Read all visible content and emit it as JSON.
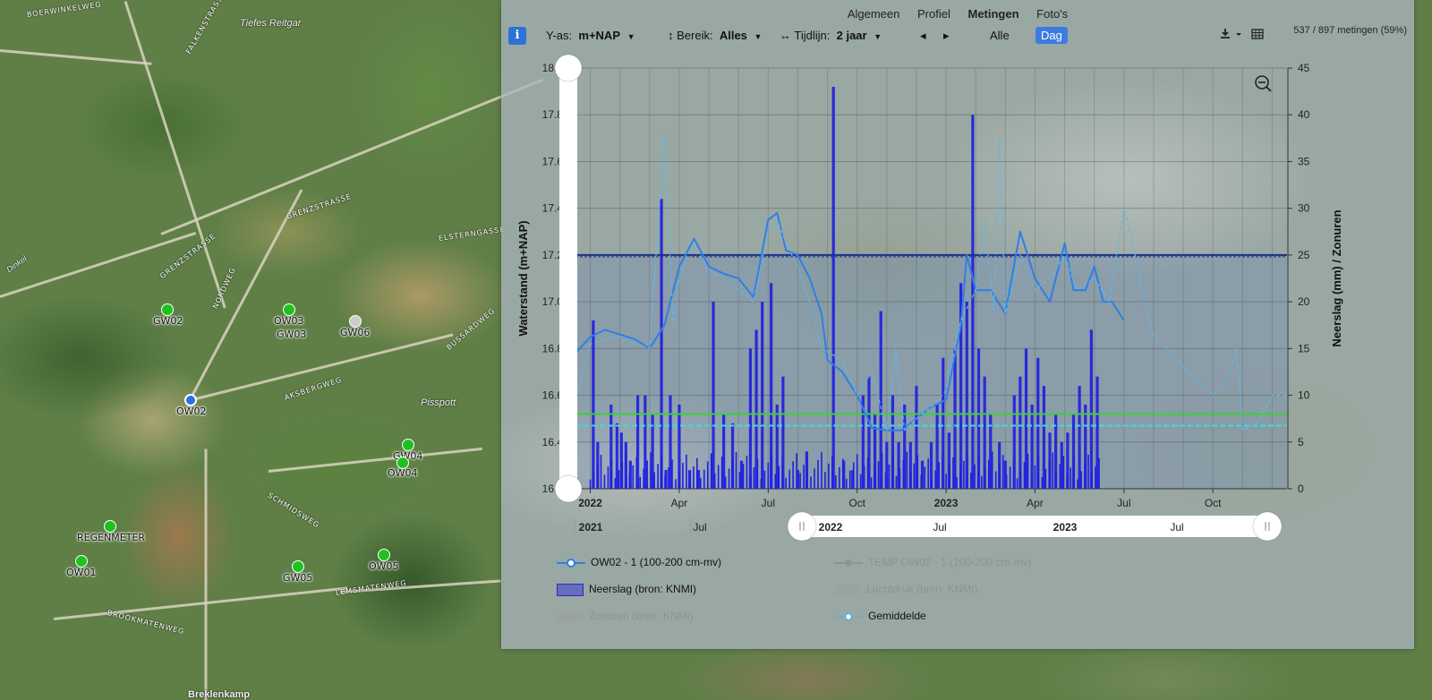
{
  "map": {
    "place_labels": [
      "Tiefes Reitgar",
      "Pisspott",
      "Breklenkamp",
      "Dinkel"
    ],
    "road_labels": [
      "BOERWINKELWEG",
      "FALKENSTRASSE",
      "GRENZSTRASSE",
      "GRENZSTRASSE",
      "NORDWEG",
      "ELSTERNGASSE",
      "BUSSARDWEG",
      "AKSBERGWEG",
      "BROOKMATENWEG",
      "LEMSMATENWEG",
      "SCHMIDSWEG"
    ],
    "markers": [
      {
        "label": "GW02",
        "color": "green"
      },
      {
        "label": "OW03",
        "color": "green"
      },
      {
        "label": "GW03",
        "color": "green"
      },
      {
        "label": "GW06",
        "color": "grey"
      },
      {
        "label": "OW02",
        "color": "blue"
      },
      {
        "label": "GW04",
        "color": "green"
      },
      {
        "label": "OW04",
        "color": "green"
      },
      {
        "label": "REGENMETER",
        "color": "green"
      },
      {
        "label": "OW01",
        "color": "green"
      },
      {
        "label": "GW05",
        "color": "green"
      },
      {
        "label": "OW05",
        "color": "green"
      }
    ]
  },
  "panel": {
    "tabs": [
      "Algemeen",
      "Profiel",
      "Metingen",
      "Foto's"
    ],
    "active_tab": "Metingen",
    "info_label": "i",
    "yas_label": "Y-as:",
    "yas_value": "m+NAP",
    "bereik_label": "Bereik:",
    "bereik_value": "Alles",
    "tijdlijn_label": "Tijdlijn:",
    "tijdlijn_value": "2 jaar",
    "prev_icon": "◂",
    "next_icon": "▸",
    "alle_label": "Alle",
    "dag_label": "Dag",
    "download_icon": "download-icon",
    "table_icon": "table-icon",
    "count_text": "537 / 897 metingen (59%)"
  },
  "chart_data": {
    "type": "line",
    "ylabel": "Waterstand (m+NAP)",
    "y2label": "Neerslag (mm) / Zonuren",
    "ylim": [
      16.2,
      18.0
    ],
    "y2lim": [
      0,
      45
    ],
    "yticks": [
      "18.0",
      "17.8",
      "17.6",
      "17.4",
      "17.2",
      "17.0",
      "16.8",
      "16.6",
      "16.4",
      "16.2"
    ],
    "y2ticks": [
      "45",
      "40",
      "35",
      "30",
      "25",
      "20",
      "15",
      "10",
      "5",
      "0"
    ],
    "xticks": [
      "2022",
      "Apr",
      "Jul",
      "Oct",
      "2023",
      "Apr",
      "Jul",
      "Oct"
    ],
    "xlim_months": [
      -0.5,
      23.5
    ],
    "reference_lines": [
      {
        "name": "high",
        "value": 17.2,
        "color": "#1b2f8a"
      },
      {
        "name": "low-green",
        "value": 16.52,
        "color": "#39d13a"
      },
      {
        "name": "Gemiddelde",
        "value": 16.47,
        "color": "#3fd8e6"
      }
    ],
    "series": [
      {
        "name": "OW02 - 1 (100-200 cm-mv)",
        "color": "#2e7fe8",
        "points": [
          [
            -0.5,
            16.78
          ],
          [
            0,
            16.85
          ],
          [
            0.5,
            16.88
          ],
          [
            1,
            16.86
          ],
          [
            1.5,
            16.84
          ],
          [
            2,
            16.8
          ],
          [
            2.5,
            16.9
          ],
          [
            3,
            17.15
          ],
          [
            3.5,
            17.27
          ],
          [
            4,
            17.15
          ],
          [
            4.5,
            17.12
          ],
          [
            5,
            17.1
          ],
          [
            5.5,
            17.02
          ],
          [
            6,
            17.35
          ],
          [
            6.3,
            17.38
          ],
          [
            6.6,
            17.22
          ],
          [
            7,
            17.2
          ],
          [
            7.4,
            17.1
          ],
          [
            7.8,
            16.95
          ],
          [
            8,
            16.75
          ],
          [
            8.5,
            16.7
          ],
          [
            9,
            16.6
          ],
          [
            9.5,
            16.46
          ],
          [
            10,
            16.45
          ],
          [
            10.5,
            16.45
          ],
          [
            11,
            16.5
          ],
          [
            11.5,
            16.55
          ],
          [
            12,
            16.58
          ],
          [
            12.5,
            16.9
          ],
          [
            12.7,
            17.2
          ],
          [
            13,
            17.05
          ],
          [
            13.5,
            17.05
          ],
          [
            14,
            16.95
          ],
          [
            14.5,
            17.3
          ],
          [
            15,
            17.1
          ],
          [
            15.5,
            17.0
          ],
          [
            16,
            17.25
          ],
          [
            16.3,
            17.05
          ],
          [
            16.7,
            17.05
          ],
          [
            17,
            17.15
          ],
          [
            17.3,
            17.0
          ],
          [
            17.6,
            17.0
          ],
          [
            18,
            16.92
          ]
        ]
      },
      {
        "name": "Gemiddelde",
        "color": "#5ab8f0",
        "dashed": true,
        "points": [
          [
            -0.5,
            16.58
          ],
          [
            0,
            16.82
          ],
          [
            0.5,
            16.84
          ],
          [
            1,
            16.85
          ],
          [
            1.5,
            16.82
          ],
          [
            2,
            16.8
          ],
          [
            2.5,
            17.72
          ],
          [
            2.8,
            16.9
          ],
          [
            3,
            17.1
          ],
          [
            3.5,
            17.25
          ],
          [
            4,
            17.13
          ],
          [
            4.5,
            17.1
          ],
          [
            5,
            17.05
          ],
          [
            5.5,
            17.0
          ],
          [
            6,
            17.3
          ],
          [
            6.3,
            17.35
          ],
          [
            6.6,
            17.25
          ],
          [
            7,
            17.15
          ],
          [
            7.4,
            17.0
          ],
          [
            7.8,
            16.8
          ],
          [
            8.5,
            16.75
          ],
          [
            9,
            16.6
          ],
          [
            9.5,
            16.7
          ],
          [
            10,
            16.45
          ],
          [
            10.3,
            16.8
          ],
          [
            10.6,
            16.45
          ],
          [
            11,
            16.5
          ],
          [
            11.5,
            16.55
          ],
          [
            12,
            16.62
          ],
          [
            12.5,
            16.92
          ],
          [
            13,
            17.05
          ],
          [
            13.3,
            17.35
          ],
          [
            13.6,
            16.95
          ],
          [
            13.8,
            17.7
          ],
          [
            14,
            16.95
          ],
          [
            14.5,
            17.2
          ],
          [
            15,
            17.05
          ],
          [
            15.5,
            17.1
          ],
          [
            16,
            17.2
          ],
          [
            16.4,
            17.05
          ],
          [
            17,
            17.1
          ],
          [
            17.5,
            17.0
          ],
          [
            18,
            17.4
          ],
          [
            18.3,
            17.25
          ],
          [
            18.6,
            17.05
          ],
          [
            19,
            16.85
          ],
          [
            19.5,
            16.8
          ],
          [
            20,
            16.72
          ],
          [
            20.5,
            16.66
          ],
          [
            21,
            16.6
          ],
          [
            21.5,
            16.68
          ],
          [
            21.8,
            16.8
          ],
          [
            22,
            16.45
          ],
          [
            22.5,
            16.48
          ],
          [
            23,
            16.6
          ],
          [
            23.5,
            16.6
          ]
        ]
      }
    ],
    "precipitation_name": "Neerslag (bron: KNMI)",
    "precipitation_bars": [
      [
        0.1,
        18
      ],
      [
        0.25,
        5
      ],
      [
        0.7,
        9
      ],
      [
        0.9,
        7
      ],
      [
        1.05,
        6
      ],
      [
        1.2,
        5
      ],
      [
        1.35,
        3
      ],
      [
        1.6,
        10
      ],
      [
        1.85,
        10
      ],
      [
        2.1,
        8
      ],
      [
        2.4,
        31
      ],
      [
        2.55,
        2
      ],
      [
        2.7,
        10
      ],
      [
        3.0,
        9
      ],
      [
        3.35,
        2
      ],
      [
        3.65,
        2
      ],
      [
        4.15,
        20
      ],
      [
        4.5,
        8
      ],
      [
        4.8,
        7
      ],
      [
        5.1,
        3
      ],
      [
        5.4,
        15
      ],
      [
        5.6,
        17
      ],
      [
        5.8,
        20
      ],
      [
        6.1,
        22
      ],
      [
        6.3,
        9
      ],
      [
        6.5,
        12
      ],
      [
        7.0,
        2
      ],
      [
        7.3,
        4
      ],
      [
        8.2,
        43
      ],
      [
        8.55,
        3
      ],
      [
        8.85,
        2
      ],
      [
        9.2,
        10
      ],
      [
        9.4,
        12
      ],
      [
        9.6,
        8
      ],
      [
        9.8,
        19
      ],
      [
        10.0,
        5
      ],
      [
        10.2,
        10
      ],
      [
        10.4,
        5
      ],
      [
        10.6,
        9
      ],
      [
        10.8,
        5
      ],
      [
        11.0,
        11
      ],
      [
        11.2,
        3
      ],
      [
        11.5,
        5
      ],
      [
        11.7,
        9
      ],
      [
        11.9,
        14
      ],
      [
        12.1,
        6
      ],
      [
        12.3,
        15
      ],
      [
        12.5,
        22
      ],
      [
        12.7,
        20
      ],
      [
        12.9,
        40
      ],
      [
        13.1,
        15
      ],
      [
        13.3,
        12
      ],
      [
        13.5,
        8
      ],
      [
        13.8,
        5
      ],
      [
        14.0,
        3
      ],
      [
        14.3,
        10
      ],
      [
        14.5,
        12
      ],
      [
        14.7,
        15
      ],
      [
        14.9,
        9
      ],
      [
        15.1,
        14
      ],
      [
        15.3,
        11
      ],
      [
        15.5,
        6
      ],
      [
        15.7,
        8
      ],
      [
        15.9,
        5
      ],
      [
        16.1,
        6
      ],
      [
        16.3,
        8
      ],
      [
        16.5,
        11
      ],
      [
        16.7,
        9
      ],
      [
        16.9,
        17
      ],
      [
        17.1,
        12
      ]
    ],
    "legend": [
      {
        "label": "OW02 - 1 (100-200 cm-mv)",
        "active": true
      },
      {
        "label": "TEMP OW02 - 1 (100-200 cm-mv)",
        "active": false
      },
      {
        "label": "Neerslag (bron: KNMI)",
        "active": true
      },
      {
        "label": "Luchtdruk (bron: KNMI)",
        "active": false
      },
      {
        "label": "Zonuren (bron: KNMI)",
        "active": false
      },
      {
        "label": "Gemiddelde",
        "active": true
      }
    ],
    "navigator_labels": [
      "2021",
      "Jul",
      "2022",
      "Jul",
      "2023",
      "Jul"
    ]
  }
}
